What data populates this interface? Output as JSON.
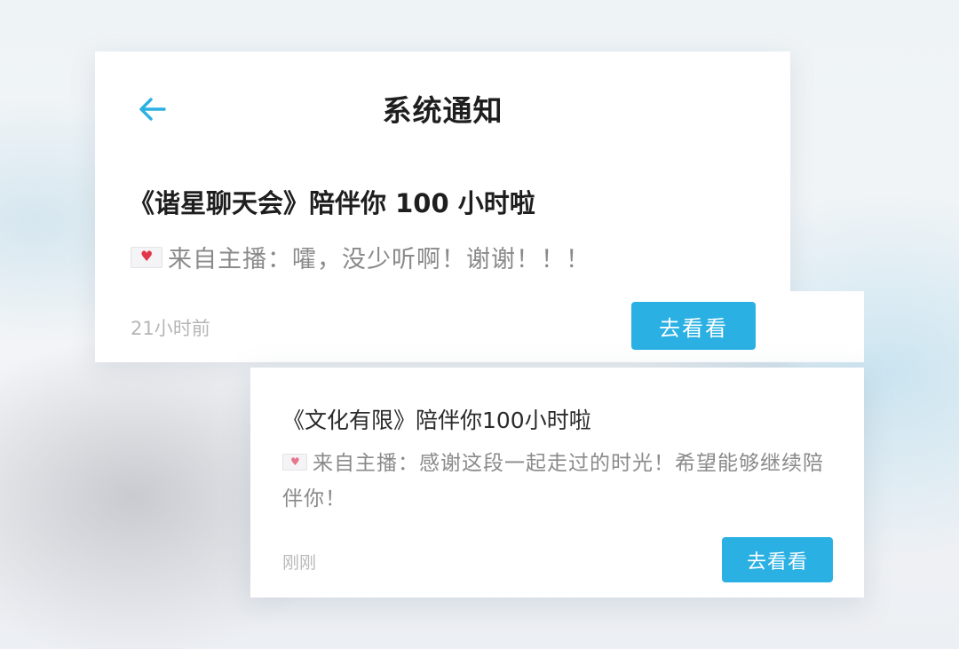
{
  "header": {
    "title": "系统通知",
    "back_icon": "arrow-left-icon",
    "accent_color": "#2bb0e3"
  },
  "notifications": [
    {
      "title": "《谐星聊天会》陪伴你 100 小时啦",
      "message": "来自主播：嚯，没少听啊！谢谢！！！",
      "message_icon": "love-letter-icon",
      "time": "21小时前",
      "button_label": "去看看"
    },
    {
      "title": "《文化有限》陪伴你100小时啦",
      "message": "来自主播：感谢这段一起走过的时光！希望能够继续陪伴你！",
      "message_icon": "love-letter-icon",
      "time": "刚刚",
      "button_label": "去看看"
    }
  ]
}
